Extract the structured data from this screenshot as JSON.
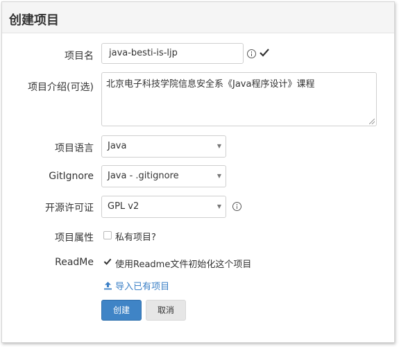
{
  "panel": {
    "title": "创建项目"
  },
  "form": {
    "project_name": {
      "label": "项目名",
      "value": "java-besti-is-ljp"
    },
    "description": {
      "label": "项目介绍(可选)",
      "value": "北京电子科技学院信息安全系《Java程序设计》课程"
    },
    "language": {
      "label": "项目语言",
      "value": "Java"
    },
    "gitignore": {
      "label": "GitIgnore",
      "value": "Java - .gitignore"
    },
    "license": {
      "label": "开源许可证",
      "value": "GPL v2"
    },
    "visibility": {
      "label": "项目属性",
      "checkbox_label": "私有项目?",
      "checked": false
    },
    "readme": {
      "label": "ReadMe",
      "checkbox_label": "使用Readme文件初始化这个项目",
      "checked": true
    },
    "import_link": "导入已有项目"
  },
  "buttons": {
    "create": "创建",
    "cancel": "取消"
  },
  "icons": {
    "info": "info-circle-icon",
    "valid": "checkmark-icon",
    "upload": "upload-icon",
    "caret": "caret-down-icon"
  },
  "colors": {
    "primary": "#3f84c6",
    "link": "#3a7fc6",
    "header_bg": "#f5f5f5"
  }
}
